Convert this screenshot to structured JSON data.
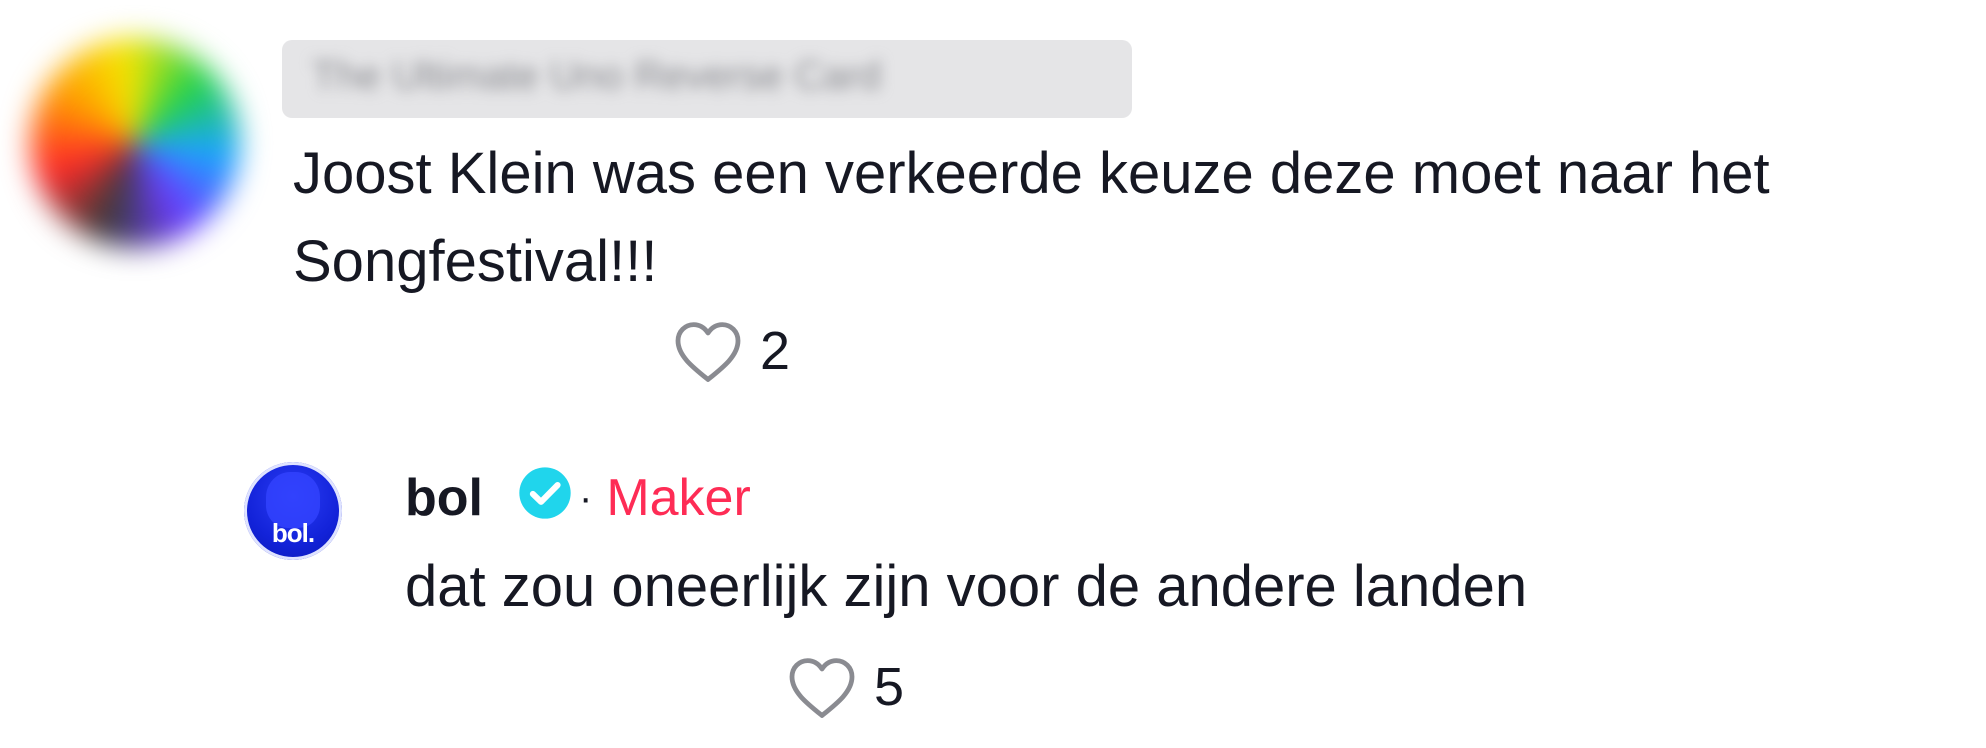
{
  "comments": [
    {
      "username": "The Ultimate Uno Reverse Card",
      "text": "Joost Klein was een verkeerde keuze deze moet naar het Songfestival!!!",
      "likes": "2"
    },
    {
      "username": "bol",
      "avatar_text": "bol.",
      "verified": true,
      "separator": "·",
      "creator_label": "Maker",
      "text": "dat zou oneerlijk zijn voor de andere landen",
      "likes": "5"
    }
  ],
  "icons": {
    "like": "heart-outline-icon",
    "verified": "verified-check-icon"
  },
  "colors": {
    "text": "#161823",
    "creator_label": "#fe2c55",
    "verified_badge": "#20d5ec",
    "like_icon": "#8a8b91",
    "bol_avatar": "#1222d8"
  }
}
